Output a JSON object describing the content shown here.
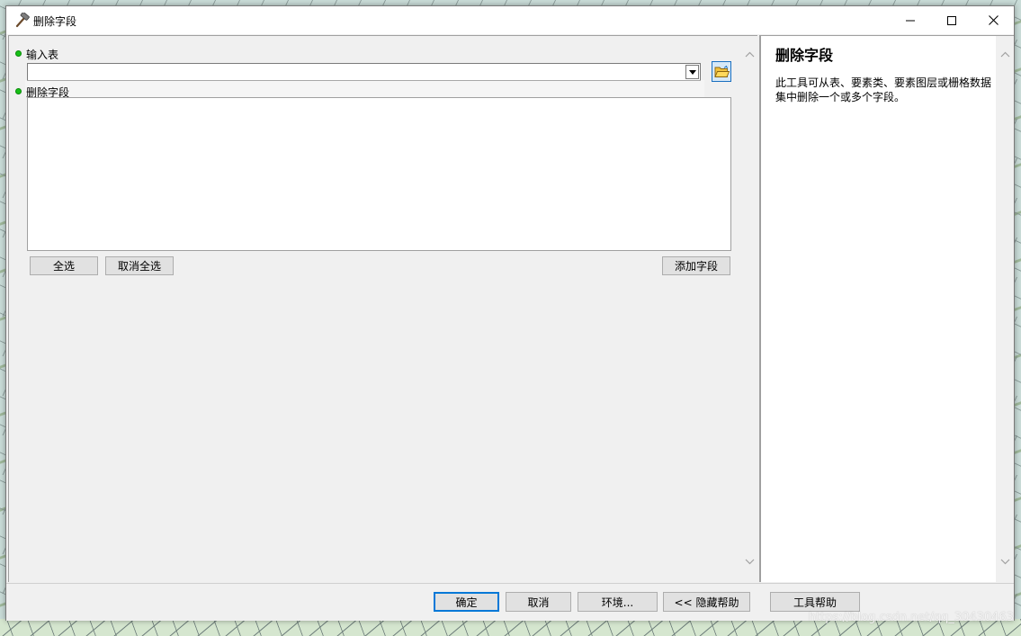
{
  "window": {
    "title": "删除字段",
    "icon": "hammer-icon",
    "controls": [
      "minimize-icon",
      "maximize-icon",
      "close-icon"
    ]
  },
  "params": {
    "input_table": {
      "label": "输入表",
      "value": "",
      "required": true
    },
    "drop_field": {
      "label": "删除字段",
      "items": [],
      "required": true
    }
  },
  "field_buttons": {
    "select_all": "全选",
    "unselect_all": "取消全选",
    "add_field": "添加字段"
  },
  "help": {
    "title": "删除字段",
    "body": "此工具可从表、要素类、要素图层或栅格数据集中删除一个或多个字段。"
  },
  "footer": {
    "ok": "确定",
    "cancel": "取消",
    "environments": "环境...",
    "hide_help": "<< 隐藏帮助",
    "tool_help": "工具帮助"
  },
  "watermark": "https://blog.csdn.net/qq_30430463",
  "colors": {
    "required_dot": "#16c016",
    "default_button_border": "#0078d7"
  }
}
